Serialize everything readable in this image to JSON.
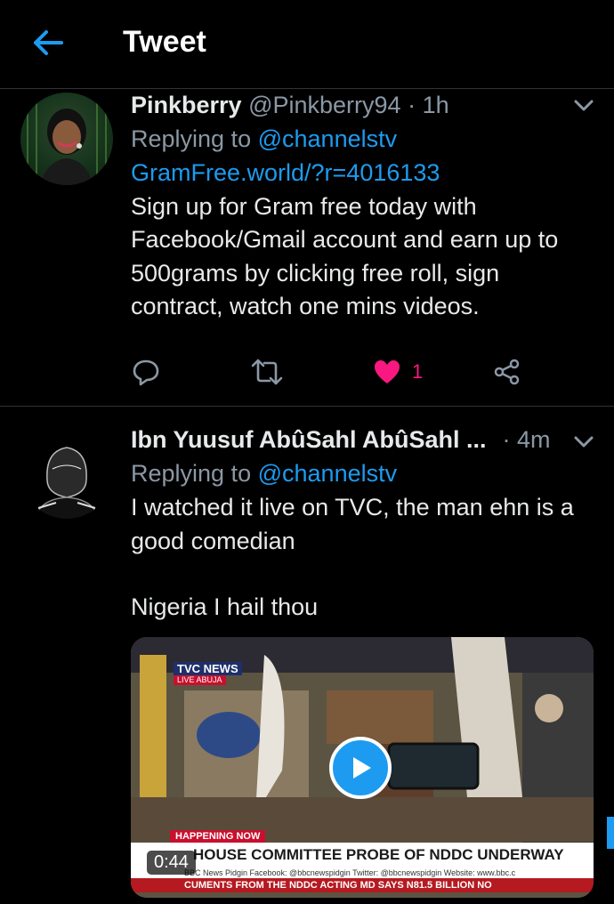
{
  "header": {
    "title": "Tweet",
    "back_icon": "arrow-left-icon"
  },
  "colors": {
    "accent": "#1d9bf0",
    "like": "#f91880",
    "background": "#000000"
  },
  "tweets": [
    {
      "display_name": "Pinkberry",
      "handle": "@Pinkberry94",
      "time": "· 1h",
      "reply_prefix": "Replying to",
      "reply_to": "@channelstv",
      "link": "GramFree.world/?r=4016133",
      "text": "Sign up for Gram free today with Facebook/Gmail account and earn up to 500grams by clicking free roll, sign contract, watch one mins videos.",
      "likes": "1",
      "liked": true
    },
    {
      "display_name": "Ibn Yuusuf AbûSahl AbûSahl ...",
      "time": "· 4m",
      "reply_prefix": "Replying to",
      "reply_to": "@channelstv",
      "text_line1": "I watched it live on TVC, the man ehn is a good comedian",
      "text_line2": "Nigeria I hail thou",
      "video": {
        "duration": "0:44",
        "channel": "TVC NEWS",
        "channel_sub": "LIVE ABUJA",
        "banner_label": "HAPPENING NOW",
        "headline": "HOUSE COMMITTEE PROBE OF NDDC UNDERWAY",
        "subline": "BBC News Pidgin   Facebook: @bbcnewspidgin   Twitter: @bbcnewspidgin   Website: www.bbc.c",
        "crawl": "CUMENTS FROM THE NDDC   ACTING MD SAYS N81.5 BILLION NO"
      }
    }
  ]
}
